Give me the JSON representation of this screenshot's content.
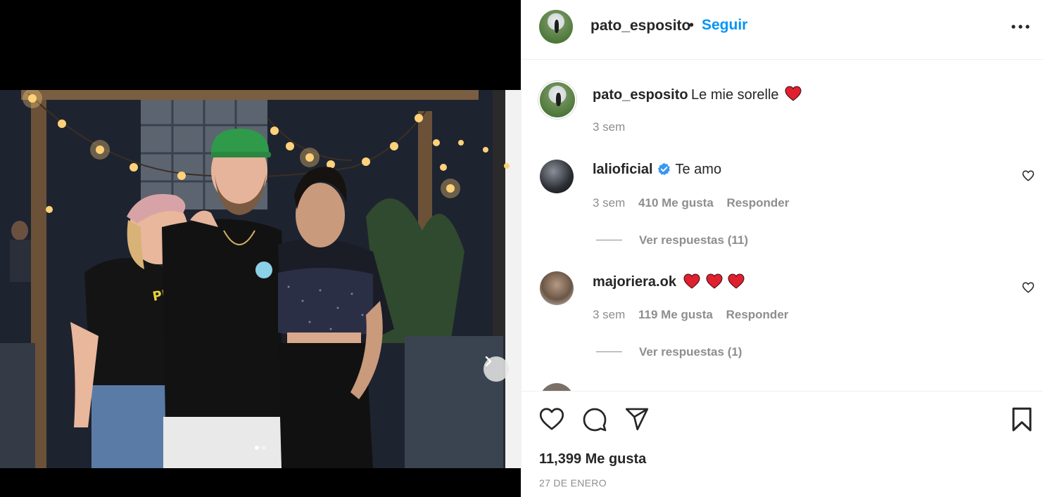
{
  "post": {
    "username": "pato_esposito",
    "follow_label": "Seguir",
    "bullet": "•",
    "caption_text": "Le mie sorelle",
    "caption_time": "3 sem",
    "likes": "11,399 Me gusta",
    "date": "27 DE ENERO",
    "carousel": {
      "count": 2,
      "active_index": 0
    }
  },
  "comments": [
    {
      "username": "lalioficial",
      "verified": true,
      "text": "Te amo",
      "time": "3 sem",
      "likes": "410 Me gusta",
      "reply_label": "Responder",
      "view_replies": "Ver respuestas (11)"
    },
    {
      "username": "majoriera.ok",
      "verified": false,
      "text": "",
      "emoji_hearts": 3,
      "time": "3 sem",
      "likes": "119 Me gusta",
      "reply_label": "Responder",
      "view_replies": "Ver respuestas (1)"
    }
  ],
  "icons": {
    "more": "more-options-icon",
    "like": "heart-icon",
    "comment": "comment-icon",
    "share": "paper-plane-icon",
    "save": "bookmark-icon",
    "next": "chevron-right-icon",
    "verified": "verified-badge-icon"
  },
  "colors": {
    "accent": "#0095f6",
    "verified": "#3897f0",
    "text": "#262626",
    "muted": "#8e8e8e",
    "emoji_heart": "#e0202f"
  }
}
